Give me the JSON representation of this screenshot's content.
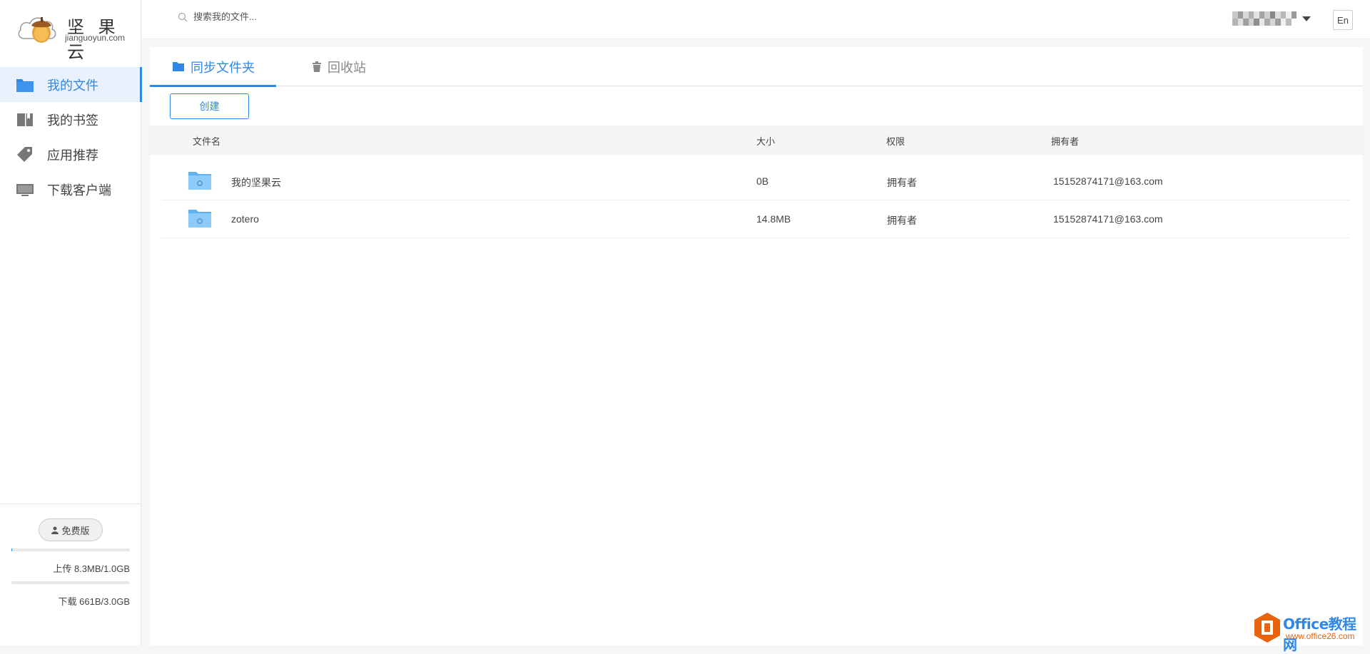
{
  "app": {
    "brand": "坚 果 云",
    "domain": "jianguoyun.com"
  },
  "sidebar": {
    "items": [
      {
        "label": "我的文件",
        "icon": "folder-icon",
        "active": true
      },
      {
        "label": "我的书签",
        "icon": "bookmark-icon",
        "active": false
      },
      {
        "label": "应用推荐",
        "icon": "tag-icon",
        "active": false
      },
      {
        "label": "下载客户端",
        "icon": "monitor-icon",
        "active": false
      }
    ],
    "plan": "免费版",
    "upload_quota": "上传 8.3MB/1.0GB",
    "upload_fraction": 0.008,
    "download_quota": "下载 661B/3.0GB",
    "download_fraction": 0.0
  },
  "header": {
    "search_placeholder": "搜索我的文件...",
    "language_button": "En"
  },
  "tabs": [
    {
      "label": "同步文件夹",
      "icon": "folder-icon",
      "active": true
    },
    {
      "label": "回收站",
      "icon": "trash-icon",
      "active": false
    }
  ],
  "toolbar": {
    "create_label": "创建"
  },
  "table": {
    "columns": [
      "文件名",
      "大小",
      "权限",
      "拥有者"
    ],
    "rows": [
      {
        "name": "我的坚果云",
        "size": "0B",
        "permission": "拥有者",
        "owner": "15152874171@163.com"
      },
      {
        "name": "zotero",
        "size": "14.8MB",
        "permission": "拥有者",
        "owner": "15152874171@163.com"
      }
    ]
  },
  "watermark": {
    "title": "Office教程网",
    "url": "www.office26.com"
  },
  "colors": {
    "accent": "#2f88e8",
    "folder": "#7cc1f5",
    "watermark_orange": "#e8630a"
  }
}
